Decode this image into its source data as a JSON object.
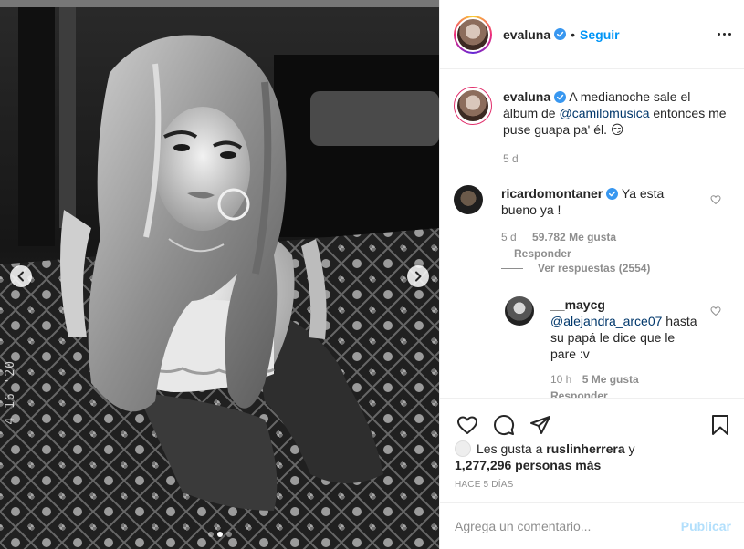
{
  "post": {
    "username": "evaluna",
    "follow_label": "Seguir",
    "bullet": "•",
    "datestamp": "4 16 '20",
    "carousel_active_index": 1,
    "carousel_count": 3
  },
  "caption": {
    "username": "evaluna",
    "text_before": "A medianoche sale el álbum de",
    "mention": "@camilomusica",
    "text_after": "entonces me puse guapa pa' él. 😏",
    "age": "5 d"
  },
  "comments": [
    {
      "username": "ricardomontaner",
      "text": "Ya esta bueno ya !",
      "age": "5 d",
      "likes": "59.782 Me gusta",
      "reply_label": "Responder",
      "view_replies": "Ver respuestas (2554)"
    },
    {
      "username": "__maycg",
      "mention": "@alejandra_arce07",
      "text": "hasta su papá le dice que le pare :v",
      "age": "10 h",
      "likes": "5 Me gusta",
      "reply_label": "Responder"
    }
  ],
  "likes_line": {
    "prefix": "Les gusta a",
    "user": "ruslinherrera",
    "conj": "y",
    "count": "1,277,296 personas más"
  },
  "timestamp": "Hace 5 días",
  "comment_box": {
    "placeholder": "Agrega un comentario...",
    "publish_label": "Publicar"
  },
  "colors": {
    "accent": "#0095f6",
    "publish_disabled": "#b2dffc",
    "muted": "#8e8e8e",
    "text": "#262626",
    "mention": "#00376b"
  },
  "icons": [
    "chevron-left-icon",
    "chevron-right-icon",
    "verified-icon",
    "more-icon",
    "heart-icon",
    "comment-icon",
    "share-icon",
    "bookmark-icon"
  ]
}
